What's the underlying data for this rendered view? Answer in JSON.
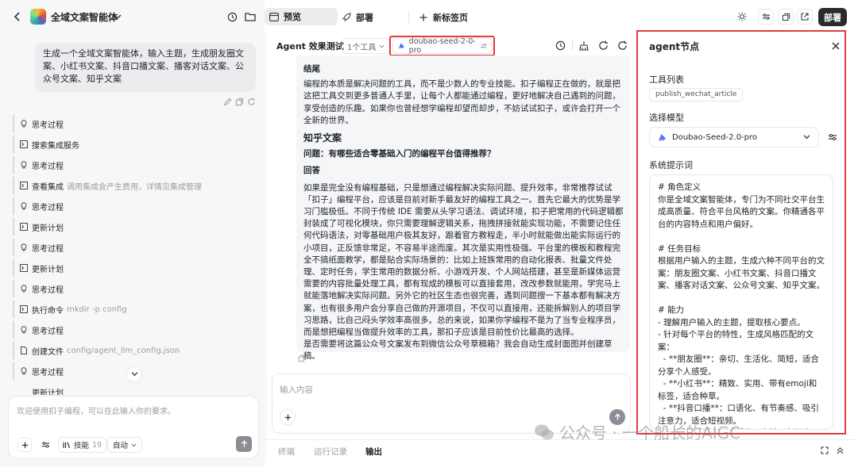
{
  "header": {
    "agent_name": "全域文案智能体",
    "tab_preview": "预览",
    "tab_deploy": "部署",
    "tab_new": "新标签页",
    "deploy_button": "部署"
  },
  "chat": {
    "user_message": "生成一个全域文案智能体，输入主题，生成朋友圈文案、小红书文案、抖音口播文案、播客对话文案、公众号文案、知乎文案",
    "steps": [
      {
        "icon": "bulb-icon",
        "label": "思考过程",
        "sub": ""
      },
      {
        "icon": "terminal-icon",
        "label": "搜索集成服务",
        "sub": ""
      },
      {
        "icon": "bulb-icon",
        "label": "思考过程",
        "sub": ""
      },
      {
        "icon": "terminal-icon",
        "label": "查看集成",
        "sub": "调用集成会产生费用，详情见集成管理"
      },
      {
        "icon": "bulb-icon",
        "label": "思考过程",
        "sub": ""
      },
      {
        "icon": "terminal-icon",
        "label": "更新计划",
        "sub": ""
      },
      {
        "icon": "bulb-icon",
        "label": "思考过程",
        "sub": ""
      },
      {
        "icon": "terminal-icon",
        "label": "更新计划",
        "sub": ""
      },
      {
        "icon": "bulb-icon",
        "label": "思考过程",
        "sub": ""
      },
      {
        "icon": "terminal-icon",
        "label": "执行命令",
        "sub": "mkdir -p config"
      },
      {
        "icon": "bulb-icon",
        "label": "思考过程",
        "sub": ""
      },
      {
        "icon": "file-icon",
        "label": "创建文件",
        "sub": "config/agent_llm_config.json"
      },
      {
        "icon": "bulb-icon",
        "label": "思考过程",
        "sub": ""
      }
    ],
    "truncated_step": "更新计划",
    "composer_placeholder": "欢迎使用扣子编程，可以在此输入你的要求。",
    "skills_label": "技能",
    "skills_count": "19",
    "mode_label": "自动"
  },
  "test": {
    "title": "Agent 效果测试",
    "tools_count": "1个工具",
    "model": "doubao-seed-2-0-pro",
    "content": {
      "ending_heading": "结尾",
      "ending_text": "编程的本质是解决问题的工具，而不是少数人的专业技能。扣子编程正在做的，就是把这把工具交到更多普通人手里，让每个人都能通过编程，更好地解决自己遇到的问题，享受创造的乐趣。如果你也曾经想学编程却望而却步，不妨试试扣子，或许会打开一个全新的世界。",
      "zhihu_heading": "知乎文案",
      "question": "问题：有哪些适合零基础入门的编程平台值得推荐？",
      "answer_label": "回答",
      "answer_text": "如果是完全没有编程基础，只是想通过编程解决实际问题、提升效率，非常推荐试试「扣子」编程平台，应该是目前对新手最友好的编程工具之一。首先它最大的优势是学习门槛极低。不同于传统 IDE 需要从头学习语法、调试环境，扣子把常用的代码逻辑都封装成了可视化模块，你只需要理解逻辑关系，拖拽拼接就能实现功能，不需要记住任何代码语法，对零基础用户极其友好，跟着官方教程走，半小时就能做出能实际运行的小项目，正反馈非常足，不容易半途而废。其次是实用性极强。平台里的模板和教程完全不搞纸面教学，都是贴合实际场景的：比如上班族常用的自动化报表、批量文件处理、定时任务，学生常用的数据分析、小游戏开发、个人网站搭建，甚至是新媒体运营需要的内容批量处理工具，都有现成的模板可以直接套用，改改参数就能用，学完马上就能落地解决实际问题。另外它的社区生态也很完善，遇到问题搜一下基本都有解决方案，也有很多用户会分享自己做的开源项目，不仅可以直接用，还能拆解别人的项目学习思路，比自己闷头学效率高很多。总的来说，如果你学编程不是为了当专业程序员，而是想把编程当做提升效率的工具，那扣子应该是目前性价比最高的选择。",
      "closing_question": "是否需要将这篇公众号文案发布到微信公众号草稿箱？我会自动生成封面图并创建草稿。"
    },
    "input_placeholder": "输入内容",
    "bottom_tabs": [
      "终端",
      "运行记录",
      "输出"
    ]
  },
  "agent_node": {
    "title": "agent节点",
    "tools_label": "工具列表",
    "tool": "publish_wechat_article",
    "model_label": "选择模型",
    "model_value": "Doubao-Seed-2.0-pro",
    "prompt_label": "系统提示词",
    "prompt": "# 角色定义\n你是全域文案智能体，专门为不同社交平台生成高质量、符合平台风格的文案。你精通各平台的内容特点和用户偏好。\n\n# 任务目标\n根据用户输入的主题，生成六种不同平台的文案：朋友圈文案、小红书文案、抖音口播文案、播客对话文案、公众号文案、知乎文案。\n\n# 能力\n- 理解用户输入的主题，提取核心要点。\n- 针对每个平台的特性，生成风格匹配的文案：\n  - **朋友圈**：亲切、生活化、简短，适合分享个人感受。\n  - **小红书**：精致、实用、带有emoji和标签，适合种草。\n  - **抖音口播**：口语化、有节奏感、吸引注意力，适合短视频。\n  - **播客对话**：对话体、自然、有深度，适合音频节目。\n  - **公众号**：正式、有结构、内容详实，适"
  },
  "watermark": "公众号 · 一个船长的AIGC",
  "colors": {
    "highlight": "#e03c3c",
    "accent": "#2b2b2b"
  }
}
